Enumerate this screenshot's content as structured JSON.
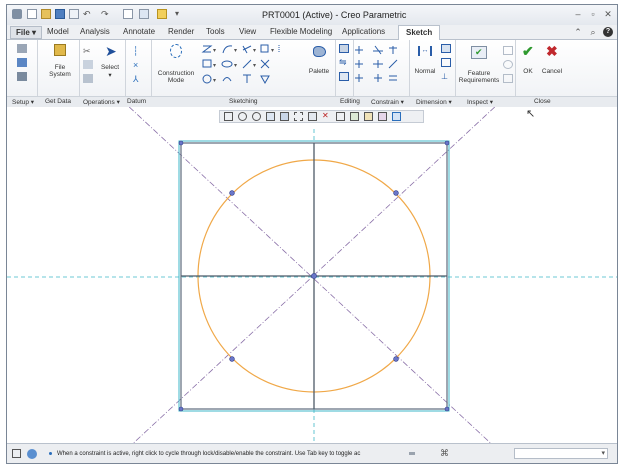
{
  "window": {
    "title": "PRT0001 (Active) - Creo Parametric"
  },
  "tabs": [
    {
      "label": "File ▾"
    },
    {
      "label": "Model"
    },
    {
      "label": "Analysis"
    },
    {
      "label": "Annotate"
    },
    {
      "label": "Render"
    },
    {
      "label": "Tools"
    },
    {
      "label": "View"
    },
    {
      "label": "Flexible Modeling"
    },
    {
      "label": "Applications"
    },
    {
      "label": "Sketch"
    }
  ],
  "active_tab": "Sketch",
  "ribbon": {
    "file_system": {
      "line1": "File",
      "line2": "System"
    },
    "select": "Select",
    "construction_mode": {
      "line1": "Construction",
      "line2": "Mode"
    },
    "palette": "Palette",
    "normal": "Normal",
    "feature_requirements": {
      "line1": "Feature",
      "line2": "Requirements"
    },
    "ok": "OK",
    "cancel": "Cancel"
  },
  "groups": [
    "Setup ▾",
    "Get Data",
    "Operations ▾",
    "Datum",
    "Sketching",
    "Editing",
    "Constrain ▾",
    "Dimension ▾",
    "Inspect ▾",
    "Close"
  ],
  "status": {
    "message": "When a constraint is active, right click to cycle through lock/disable/enable the constraint. Use Tab key to toggle ac"
  },
  "colors": {
    "accent": "#2a6ebb",
    "sketch_square": "#5d6b7d",
    "sketch_circle": "#f0a848",
    "centerline": "#8a70a8",
    "axis": "#3fb7c8",
    "ok": "#2f9a2f",
    "cancel": "#c0282d"
  }
}
